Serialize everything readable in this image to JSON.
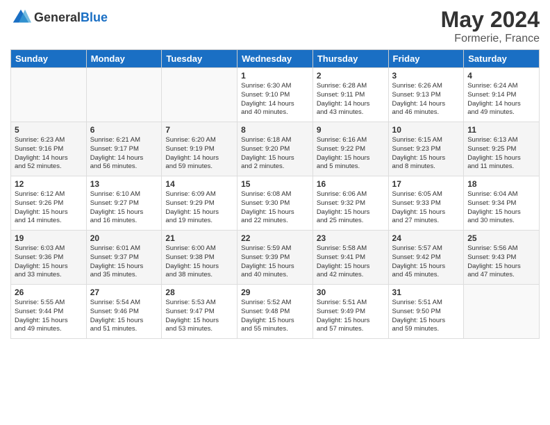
{
  "header": {
    "logo_general": "General",
    "logo_blue": "Blue",
    "month": "May 2024",
    "location": "Formerie, France"
  },
  "weekdays": [
    "Sunday",
    "Monday",
    "Tuesday",
    "Wednesday",
    "Thursday",
    "Friday",
    "Saturday"
  ],
  "weeks": [
    [
      {
        "day": "",
        "info": ""
      },
      {
        "day": "",
        "info": ""
      },
      {
        "day": "",
        "info": ""
      },
      {
        "day": "1",
        "info": "Sunrise: 6:30 AM\nSunset: 9:10 PM\nDaylight: 14 hours\nand 40 minutes."
      },
      {
        "day": "2",
        "info": "Sunrise: 6:28 AM\nSunset: 9:11 PM\nDaylight: 14 hours\nand 43 minutes."
      },
      {
        "day": "3",
        "info": "Sunrise: 6:26 AM\nSunset: 9:13 PM\nDaylight: 14 hours\nand 46 minutes."
      },
      {
        "day": "4",
        "info": "Sunrise: 6:24 AM\nSunset: 9:14 PM\nDaylight: 14 hours\nand 49 minutes."
      }
    ],
    [
      {
        "day": "5",
        "info": "Sunrise: 6:23 AM\nSunset: 9:16 PM\nDaylight: 14 hours\nand 52 minutes."
      },
      {
        "day": "6",
        "info": "Sunrise: 6:21 AM\nSunset: 9:17 PM\nDaylight: 14 hours\nand 56 minutes."
      },
      {
        "day": "7",
        "info": "Sunrise: 6:20 AM\nSunset: 9:19 PM\nDaylight: 14 hours\nand 59 minutes."
      },
      {
        "day": "8",
        "info": "Sunrise: 6:18 AM\nSunset: 9:20 PM\nDaylight: 15 hours\nand 2 minutes."
      },
      {
        "day": "9",
        "info": "Sunrise: 6:16 AM\nSunset: 9:22 PM\nDaylight: 15 hours\nand 5 minutes."
      },
      {
        "day": "10",
        "info": "Sunrise: 6:15 AM\nSunset: 9:23 PM\nDaylight: 15 hours\nand 8 minutes."
      },
      {
        "day": "11",
        "info": "Sunrise: 6:13 AM\nSunset: 9:25 PM\nDaylight: 15 hours\nand 11 minutes."
      }
    ],
    [
      {
        "day": "12",
        "info": "Sunrise: 6:12 AM\nSunset: 9:26 PM\nDaylight: 15 hours\nand 14 minutes."
      },
      {
        "day": "13",
        "info": "Sunrise: 6:10 AM\nSunset: 9:27 PM\nDaylight: 15 hours\nand 16 minutes."
      },
      {
        "day": "14",
        "info": "Sunrise: 6:09 AM\nSunset: 9:29 PM\nDaylight: 15 hours\nand 19 minutes."
      },
      {
        "day": "15",
        "info": "Sunrise: 6:08 AM\nSunset: 9:30 PM\nDaylight: 15 hours\nand 22 minutes."
      },
      {
        "day": "16",
        "info": "Sunrise: 6:06 AM\nSunset: 9:32 PM\nDaylight: 15 hours\nand 25 minutes."
      },
      {
        "day": "17",
        "info": "Sunrise: 6:05 AM\nSunset: 9:33 PM\nDaylight: 15 hours\nand 27 minutes."
      },
      {
        "day": "18",
        "info": "Sunrise: 6:04 AM\nSunset: 9:34 PM\nDaylight: 15 hours\nand 30 minutes."
      }
    ],
    [
      {
        "day": "19",
        "info": "Sunrise: 6:03 AM\nSunset: 9:36 PM\nDaylight: 15 hours\nand 33 minutes."
      },
      {
        "day": "20",
        "info": "Sunrise: 6:01 AM\nSunset: 9:37 PM\nDaylight: 15 hours\nand 35 minutes."
      },
      {
        "day": "21",
        "info": "Sunrise: 6:00 AM\nSunset: 9:38 PM\nDaylight: 15 hours\nand 38 minutes."
      },
      {
        "day": "22",
        "info": "Sunrise: 5:59 AM\nSunset: 9:39 PM\nDaylight: 15 hours\nand 40 minutes."
      },
      {
        "day": "23",
        "info": "Sunrise: 5:58 AM\nSunset: 9:41 PM\nDaylight: 15 hours\nand 42 minutes."
      },
      {
        "day": "24",
        "info": "Sunrise: 5:57 AM\nSunset: 9:42 PM\nDaylight: 15 hours\nand 45 minutes."
      },
      {
        "day": "25",
        "info": "Sunrise: 5:56 AM\nSunset: 9:43 PM\nDaylight: 15 hours\nand 47 minutes."
      }
    ],
    [
      {
        "day": "26",
        "info": "Sunrise: 5:55 AM\nSunset: 9:44 PM\nDaylight: 15 hours\nand 49 minutes."
      },
      {
        "day": "27",
        "info": "Sunrise: 5:54 AM\nSunset: 9:46 PM\nDaylight: 15 hours\nand 51 minutes."
      },
      {
        "day": "28",
        "info": "Sunrise: 5:53 AM\nSunset: 9:47 PM\nDaylight: 15 hours\nand 53 minutes."
      },
      {
        "day": "29",
        "info": "Sunrise: 5:52 AM\nSunset: 9:48 PM\nDaylight: 15 hours\nand 55 minutes."
      },
      {
        "day": "30",
        "info": "Sunrise: 5:51 AM\nSunset: 9:49 PM\nDaylight: 15 hours\nand 57 minutes."
      },
      {
        "day": "31",
        "info": "Sunrise: 5:51 AM\nSunset: 9:50 PM\nDaylight: 15 hours\nand 59 minutes."
      },
      {
        "day": "",
        "info": ""
      }
    ]
  ]
}
